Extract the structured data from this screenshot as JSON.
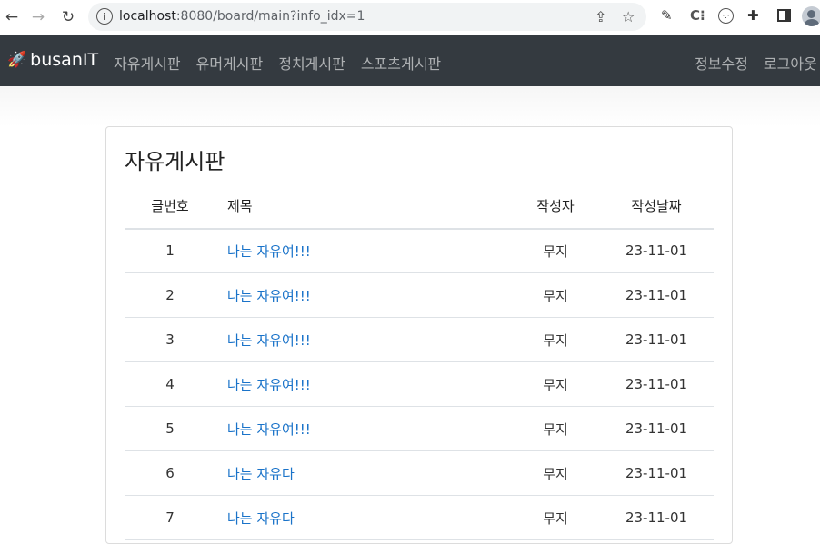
{
  "browser": {
    "url_host": "localhost",
    "url_path": ":8080/board/main?info_idx=1"
  },
  "navbar": {
    "brand": "busanIT",
    "menu": [
      "자유게시판",
      "유머게시판",
      "정치게시판",
      "스포츠게시판"
    ],
    "right_menu": [
      "정보수정",
      "로그아웃"
    ]
  },
  "board": {
    "title": "자유게시판",
    "columns": {
      "no": "글번호",
      "title": "제목",
      "author": "작성자",
      "date": "작성날짜"
    },
    "rows": [
      {
        "no": "1",
        "title": "나는 자유여!!!",
        "author": "무지",
        "date": "23-11-01"
      },
      {
        "no": "2",
        "title": "나는 자유여!!!",
        "author": "무지",
        "date": "23-11-01"
      },
      {
        "no": "3",
        "title": "나는 자유여!!!",
        "author": "무지",
        "date": "23-11-01"
      },
      {
        "no": "4",
        "title": "나는 자유여!!!",
        "author": "무지",
        "date": "23-11-01"
      },
      {
        "no": "5",
        "title": "나는 자유여!!!",
        "author": "무지",
        "date": "23-11-01"
      },
      {
        "no": "6",
        "title": "나는 자유다",
        "author": "무지",
        "date": "23-11-01"
      },
      {
        "no": "7",
        "title": "나는 자유다",
        "author": "무지",
        "date": "23-11-01"
      }
    ]
  },
  "colors": {
    "navbar_bg": "#343a40",
    "link": "#1a73c9"
  }
}
